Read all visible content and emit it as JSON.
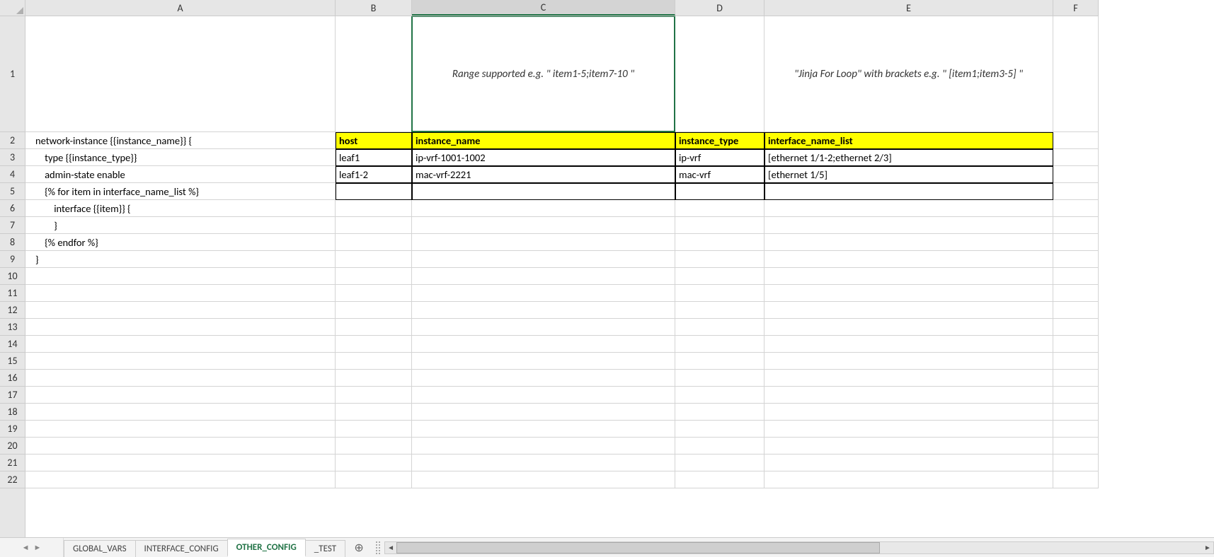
{
  "columns": [
    {
      "letter": "A",
      "width": "col-A"
    },
    {
      "letter": "B",
      "width": "col-B"
    },
    {
      "letter": "C",
      "width": "col-C",
      "active": true
    },
    {
      "letter": "D",
      "width": "col-D"
    },
    {
      "letter": "E",
      "width": "col-E"
    },
    {
      "letter": "F",
      "width": "col-F"
    }
  ],
  "row1": {
    "C_text": "Range supported e.g. \" item1-5;item7-10 \"",
    "E_text": "\"Jinja For Loop\" with brackets e.g. \" [item1;item3-5] \""
  },
  "colA": {
    "r2": "network-instance {{instance_name}} {",
    "r3": "    type {{instance_type}}",
    "r4": "    admin-state enable",
    "r5": "    {% for item in interface_name_list %}",
    "r6": "        interface {{item}} {",
    "r7": "        }",
    "r8": "    {% endfor %}",
    "r9": "}"
  },
  "table": {
    "headers": {
      "B": "host",
      "C": "instance_name",
      "D": "instance_type",
      "E": "interface_name_list"
    },
    "rows": [
      {
        "B": "leaf1",
        "C": "ip-vrf-1001-1002",
        "D": "ip-vrf",
        "E": "[ethernet 1/1-2;ethernet 2/3]"
      },
      {
        "B": "leaf1-2",
        "C": "mac-vrf-2221",
        "D": "mac-vrf",
        "E": "[ethernet 1/5]"
      },
      {
        "B": "",
        "C": "",
        "D": "",
        "E": ""
      }
    ]
  },
  "tabs": [
    "GLOBAL_VARS",
    "INTERFACE_CONFIG",
    "OTHER_CONFIG",
    "_TEST"
  ],
  "active_tab": "OTHER_CONFIG",
  "row_count": 22,
  "chart_data": {
    "type": "table",
    "headers": [
      "host",
      "instance_name",
      "instance_type",
      "interface_name_list"
    ],
    "rows": [
      [
        "leaf1",
        "ip-vrf-1001-1002",
        "ip-vrf",
        "[ethernet 1/1-2;ethernet 2/3]"
      ],
      [
        "leaf1-2",
        "mac-vrf-2221",
        "mac-vrf",
        "[ethernet 1/5]"
      ]
    ]
  }
}
